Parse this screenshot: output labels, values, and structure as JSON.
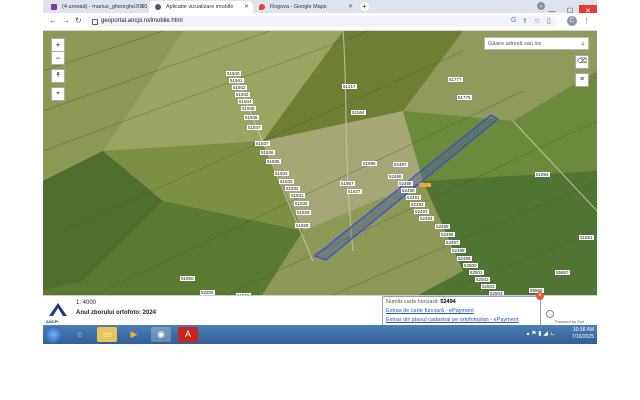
{
  "browser": {
    "tabs": [
      {
        "label": "(4 unread) - marius_gheorghe2010",
        "icon_color": "#7e3bb5",
        "active": false
      },
      {
        "label": "Aplicatie vizualizare imobile",
        "icon_color": "#555555",
        "active": true
      },
      {
        "label": "Rogova - Google Maps",
        "icon_color": "#e0463a",
        "active": false
      }
    ],
    "new_tab": "+",
    "url": "geoportal.ancpi.ro/imobile.html",
    "profile_initial": "C"
  },
  "map": {
    "search_placeholder": "Găsire adresă sau loc",
    "zoom_in": "+",
    "zoom_out": "−",
    "parcel_labels": [
      {
        "text": "51940"
      },
      {
        "text": "51941"
      },
      {
        "text": "51942"
      },
      {
        "text": "51943"
      },
      {
        "text": "51944"
      },
      {
        "text": "51945"
      },
      {
        "text": "51946"
      },
      {
        "text": "51947"
      },
      {
        "text": "51937"
      },
      {
        "text": "51936"
      },
      {
        "text": "51935"
      },
      {
        "text": "51934"
      },
      {
        "text": "51933"
      },
      {
        "text": "51932"
      },
      {
        "text": "51931"
      },
      {
        "text": "51930"
      },
      {
        "text": "51929"
      },
      {
        "text": "51928"
      },
      {
        "text": "51217"
      },
      {
        "text": "51564"
      },
      {
        "text": "51777"
      },
      {
        "text": "51775"
      },
      {
        "text": "51996"
      },
      {
        "text": "52487"
      },
      {
        "text": "52488"
      },
      {
        "text": "51957"
      },
      {
        "text": "51927"
      },
      {
        "text": "52489"
      },
      {
        "text": "52490"
      },
      {
        "text": "52491"
      },
      {
        "text": "52492"
      },
      {
        "text": "52493"
      },
      {
        "text": "52494"
      },
      {
        "text": "52495"
      },
      {
        "text": "52496"
      },
      {
        "text": "52497"
      },
      {
        "text": "52498"
      },
      {
        "text": "52499"
      },
      {
        "text": "52500"
      },
      {
        "text": "52501"
      },
      {
        "text": "52502"
      },
      {
        "text": "52503"
      },
      {
        "text": "52504"
      },
      {
        "text": "51950"
      },
      {
        "text": "52200"
      },
      {
        "text": "51994"
      },
      {
        "text": "55867"
      },
      {
        "text": "55866"
      },
      {
        "text": "51881"
      },
      {
        "text": "51998"
      }
    ]
  },
  "footer": {
    "logo_text": "ANCPI",
    "scale": "1: 4000",
    "ortho_year": "Anul zborului ortofoto: 2024",
    "popup": {
      "cf_label": "Număr carte funciară:",
      "cf_value": "52494",
      "link1": "Extras de carte funciară - ePayment",
      "link2": "Extras din planul cadastral pe ortofotoplan - ePayment",
      "close": "×"
    },
    "powered": "Powered by Esri"
  },
  "taskbar": {
    "time": "10:38 AM",
    "date": "7/16/2025"
  }
}
